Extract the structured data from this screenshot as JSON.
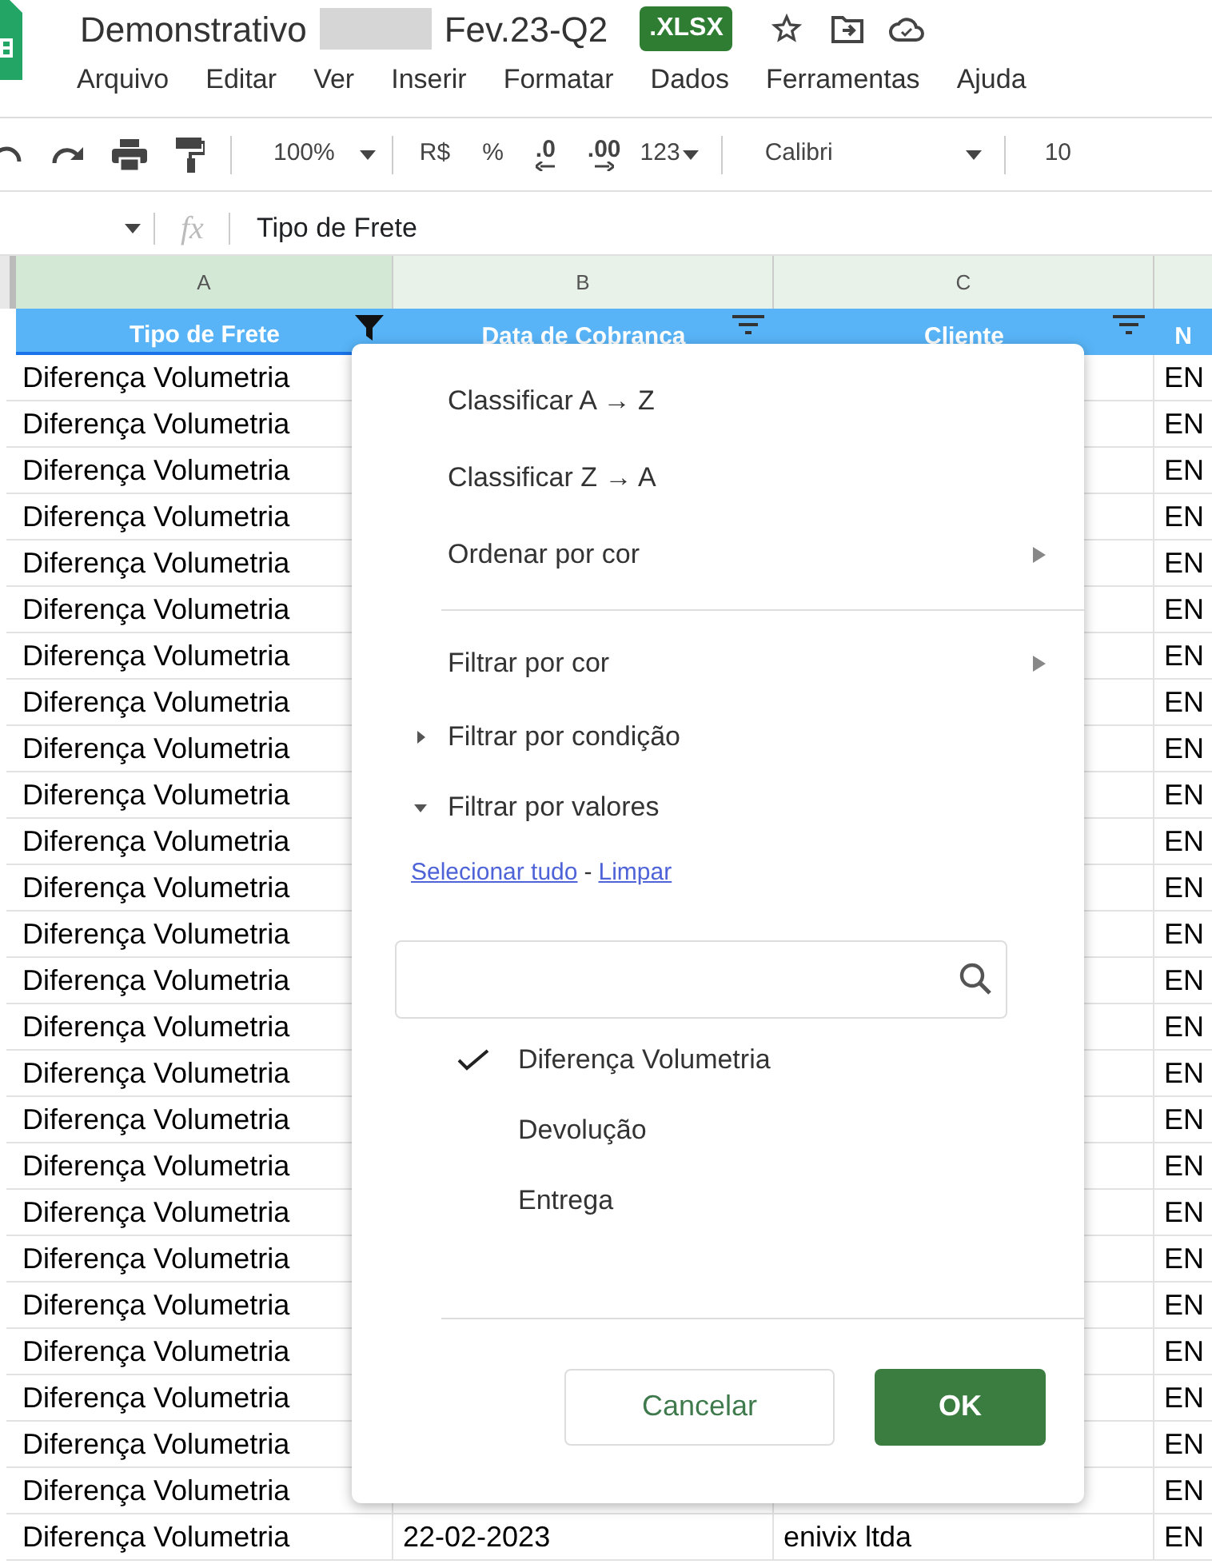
{
  "document": {
    "title_start": "Demonstrativo",
    "title_end": "Fev.23-Q2",
    "badge": ".XLSX"
  },
  "menu_bar": [
    "Arquivo",
    "Editar",
    "Ver",
    "Inserir",
    "Formatar",
    "Dados",
    "Ferramentas",
    "Ajuda"
  ],
  "toolbar": {
    "zoom": "100%",
    "currency": "R$",
    "percent": "%",
    "decimals_less": ".0",
    "decimals_more": ".00",
    "number_format": "123",
    "font": "Calibri",
    "font_size": "10"
  },
  "formula_bar": {
    "fx": "fx",
    "value": "Tipo de Frete"
  },
  "column_letters": [
    {
      "label": "A",
      "selected": true
    },
    {
      "label": "B",
      "selected": false
    },
    {
      "label": "C",
      "selected": false
    }
  ],
  "header_row": [
    {
      "label": "Tipo de Frete",
      "filtered": true
    },
    {
      "label": "Data de Cobranca",
      "filtered": false
    },
    {
      "label": "Cliente",
      "filtered": false
    },
    {
      "label": "N",
      "filtered": false
    }
  ],
  "rows": [
    {
      "a": "Diferença Volumetria",
      "d": "EN"
    },
    {
      "a": "Diferença Volumetria",
      "d": "EN"
    },
    {
      "a": "Diferença Volumetria",
      "d": "EN"
    },
    {
      "a": "Diferença Volumetria",
      "d": "EN"
    },
    {
      "a": "Diferença Volumetria",
      "d": "EN"
    },
    {
      "a": "Diferença Volumetria",
      "d": "EN"
    },
    {
      "a": "Diferença Volumetria",
      "d": "EN"
    },
    {
      "a": "Diferença Volumetria",
      "d": "EN"
    },
    {
      "a": "Diferença Volumetria",
      "d": "EN"
    },
    {
      "a": "Diferença Volumetria",
      "d": "EN"
    },
    {
      "a": "Diferença Volumetria",
      "d": "EN"
    },
    {
      "a": "Diferença Volumetria",
      "d": "EN"
    },
    {
      "a": "Diferença Volumetria",
      "d": "EN"
    },
    {
      "a": "Diferença Volumetria",
      "d": "EN"
    },
    {
      "a": "Diferença Volumetria",
      "d": "EN"
    },
    {
      "a": "Diferença Volumetria",
      "d": "EN"
    },
    {
      "a": "Diferença Volumetria",
      "d": "EN"
    },
    {
      "a": "Diferença Volumetria",
      "d": "EN"
    },
    {
      "a": "Diferença Volumetria",
      "d": "EN"
    },
    {
      "a": "Diferença Volumetria",
      "d": "EN"
    },
    {
      "a": "Diferença Volumetria",
      "d": "EN"
    },
    {
      "a": "Diferença Volumetria",
      "d": "EN"
    },
    {
      "a": "Diferença Volumetria",
      "d": "EN"
    },
    {
      "a": "Diferença Volumetria",
      "d": "EN"
    },
    {
      "a": "Diferença Volumetria",
      "d": "EN"
    },
    {
      "a": "Diferença Volumetria",
      "b": "22-02-2023",
      "c": "enivix ltda",
      "d": "EN"
    }
  ],
  "filter_menu": {
    "items": [
      {
        "kind": "action",
        "label": "Classificar A → Z"
      },
      {
        "kind": "action",
        "label": "Classificar Z → A"
      },
      {
        "kind": "submenu",
        "label": "Ordenar por cor"
      },
      {
        "kind": "divider"
      },
      {
        "kind": "submenu",
        "label": "Filtrar por cor"
      },
      {
        "kind": "section",
        "label": "Filtrar por condição",
        "expanded": false
      },
      {
        "kind": "section",
        "label": "Filtrar por valores",
        "expanded": true
      }
    ],
    "select_all": "Selecionar tudo",
    "separator": "-",
    "clear": "Limpar",
    "values": [
      {
        "label": "Diferença Volumetria",
        "checked": true
      },
      {
        "label": "Devolução",
        "checked": false
      },
      {
        "label": "Entrega",
        "checked": false
      }
    ],
    "cancel": "Cancelar",
    "ok": "OK"
  }
}
